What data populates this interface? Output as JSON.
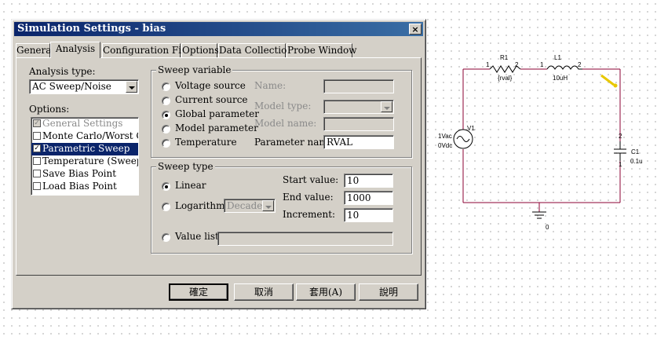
{
  "dialog": {
    "title": "Simulation Settings - bias",
    "close_glyph": "×",
    "tabs": [
      {
        "label": "General"
      },
      {
        "label": "Analysis"
      },
      {
        "label": "Configuration Files"
      },
      {
        "label": "Options"
      },
      {
        "label": "Data Collection"
      },
      {
        "label": "Probe Window"
      }
    ],
    "analysis_type_label": "Analysis type:",
    "analysis_type_value": "AC Sweep/Noise",
    "options_label": "Options:",
    "options": [
      {
        "label": "General Settings",
        "checked": true,
        "disabled": true
      },
      {
        "label": "Monte Carlo/Worst Case",
        "checked": false
      },
      {
        "label": "Parametric Sweep",
        "checked": true,
        "selected": true
      },
      {
        "label": "Temperature (Sweep)",
        "checked": false
      },
      {
        "label": "Save Bias Point",
        "checked": false
      },
      {
        "label": "Load Bias Point",
        "checked": false
      }
    ],
    "sweep_variable": {
      "title": "Sweep variable",
      "radios": [
        "Voltage source",
        "Current source",
        "Global parameter",
        "Model parameter",
        "Temperature"
      ],
      "selected": "Global parameter",
      "name_label": "Name:",
      "model_type_label": "Model type:",
      "model_name_label": "Model name:",
      "parameter_name_label": "Parameter name:",
      "parameter_name_value": "RVAL"
    },
    "sweep_type": {
      "title": "Sweep type",
      "linear_label": "Linear",
      "log_label": "Logarithmic",
      "log_value": "Decade",
      "value_list_label": "Value list",
      "start_label": "Start value:",
      "start_value": "10",
      "end_label": "End value:",
      "end_value": "1000",
      "increment_label": "Increment:",
      "increment_value": "10"
    },
    "buttons": {
      "ok": "確定",
      "cancel": "取消",
      "apply": "套用(A)",
      "help": "說明"
    }
  },
  "schematic": {
    "r1_ref": "R1",
    "r1_value": "{rval}",
    "l1_ref": "L1",
    "l1_value": "10uH",
    "c1_ref": "C1",
    "c1_value": "0.1u",
    "v1_ref": "V1",
    "v1_ac": "1Vac",
    "v1_dc": "0Vdc",
    "ground_label": "0",
    "pin_1": "1",
    "pin_2": "2",
    "wire_color": "#8b0033"
  }
}
